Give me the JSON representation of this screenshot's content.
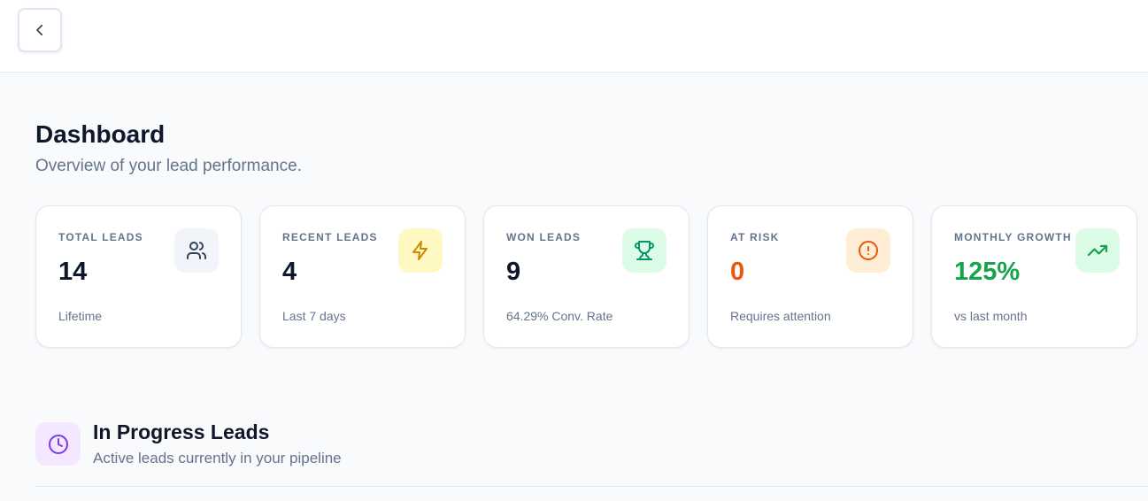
{
  "header": {
    "back_icon": "chevron-left-icon"
  },
  "page": {
    "title": "Dashboard",
    "subtitle": "Overview of your lead performance."
  },
  "stats": [
    {
      "label": "TOTAL LEADS",
      "value": "14",
      "note": "Lifetime",
      "icon": "users-icon",
      "icon_bg": "#f1f5f9",
      "icon_color": "#334155",
      "value_color": "#0f172a"
    },
    {
      "label": "RECENT LEADS",
      "value": "4",
      "note": "Last 7 days",
      "icon": "lightning-icon",
      "icon_bg": "#fef9c3",
      "icon_color": "#ca8a04",
      "value_color": "#0f172a"
    },
    {
      "label": "WON LEADS",
      "value": "9",
      "note": "64.29% Conv. Rate",
      "icon": "trophy-icon",
      "icon_bg": "#dcfce7",
      "icon_color": "#059669",
      "value_color": "#0f172a"
    },
    {
      "label": "AT RISK",
      "value": "0",
      "note": "Requires attention",
      "icon": "alert-circle-icon",
      "icon_bg": "#ffedd5",
      "icon_color": "#ea580c",
      "value_color": "#ea580c"
    },
    {
      "label": "MONTHLY GROWTH",
      "value": "125%",
      "note": "vs last month",
      "icon": "trending-up-icon",
      "icon_bg": "#dcfce7",
      "icon_color": "#16a34a",
      "value_color": "#16a34a"
    }
  ],
  "section": {
    "title": "In Progress Leads",
    "subtitle": "Active leads currently in your pipeline",
    "icon": "clock-icon",
    "icon_color": "#7c3aed"
  }
}
